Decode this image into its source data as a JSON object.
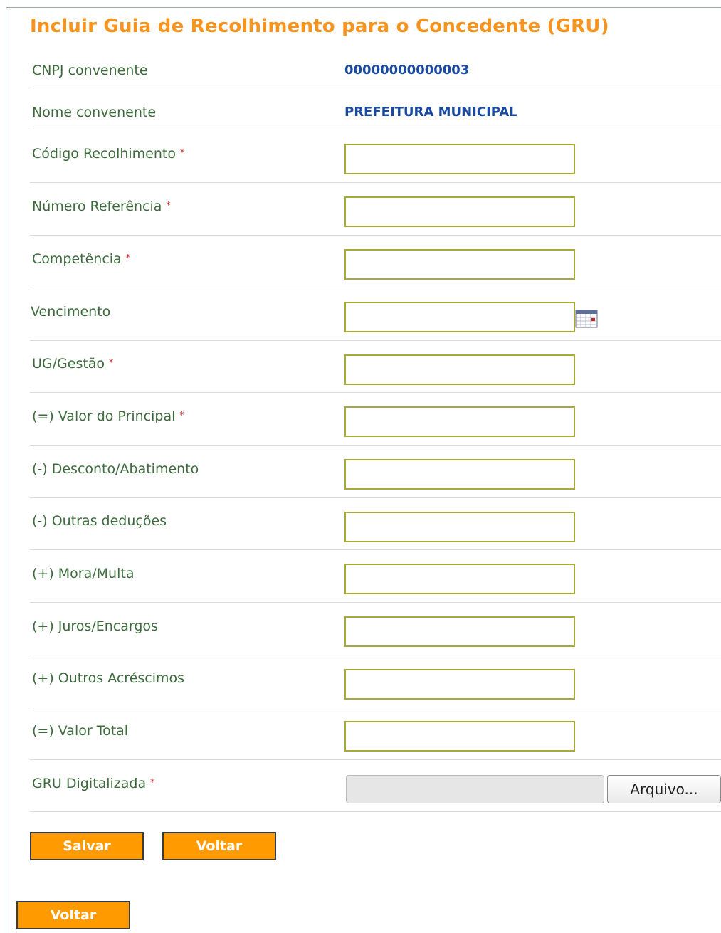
{
  "title": "Incluir Guia de Recolhimento para o Concedente (GRU)",
  "info": {
    "cnpj_label": "CNPJ convenente",
    "cnpj_value": "00000000000003",
    "nome_label": "Nome convenente",
    "nome_value": "PREFEITURA MUNICIPAL"
  },
  "fields": {
    "codigo": {
      "label": "Código Recolhimento",
      "required": "*",
      "value": ""
    },
    "numero": {
      "label": "Número Referência",
      "required": "*",
      "value": ""
    },
    "competencia": {
      "label": "Competência",
      "required": "*",
      "value": ""
    },
    "vencimento": {
      "label": "Vencimento",
      "value": ""
    },
    "ug": {
      "label": "UG/Gestão",
      "required": "*",
      "value": ""
    },
    "principal": {
      "label": "(=) Valor do Principal",
      "required": "*",
      "value": ""
    },
    "desconto": {
      "label": "(-) Desconto/Abatimento",
      "value": ""
    },
    "deducoes": {
      "label": "(-) Outras deduções",
      "value": ""
    },
    "mora": {
      "label": "(+) Mora/Multa",
      "value": ""
    },
    "juros": {
      "label": "(+) Juros/Encargos",
      "value": ""
    },
    "acrescimos": {
      "label": "(+) Outros Acréscimos",
      "value": ""
    },
    "total": {
      "label": "(=) Valor Total",
      "value": ""
    }
  },
  "upload": {
    "label": "GRU Digitalizada",
    "required": "*",
    "button_label": "Arquivo..."
  },
  "buttons": {
    "salvar": "Salvar",
    "voltar": "Voltar",
    "voltar_bottom": "Voltar"
  },
  "icons": {
    "calendar": "calendar-icon"
  },
  "colors": {
    "title": "#f7941d",
    "label": "#3d6b3d",
    "value": "#1a4aa0",
    "required": "#e02020",
    "button": "#ff9a00",
    "input_border": "#a9a93a"
  }
}
